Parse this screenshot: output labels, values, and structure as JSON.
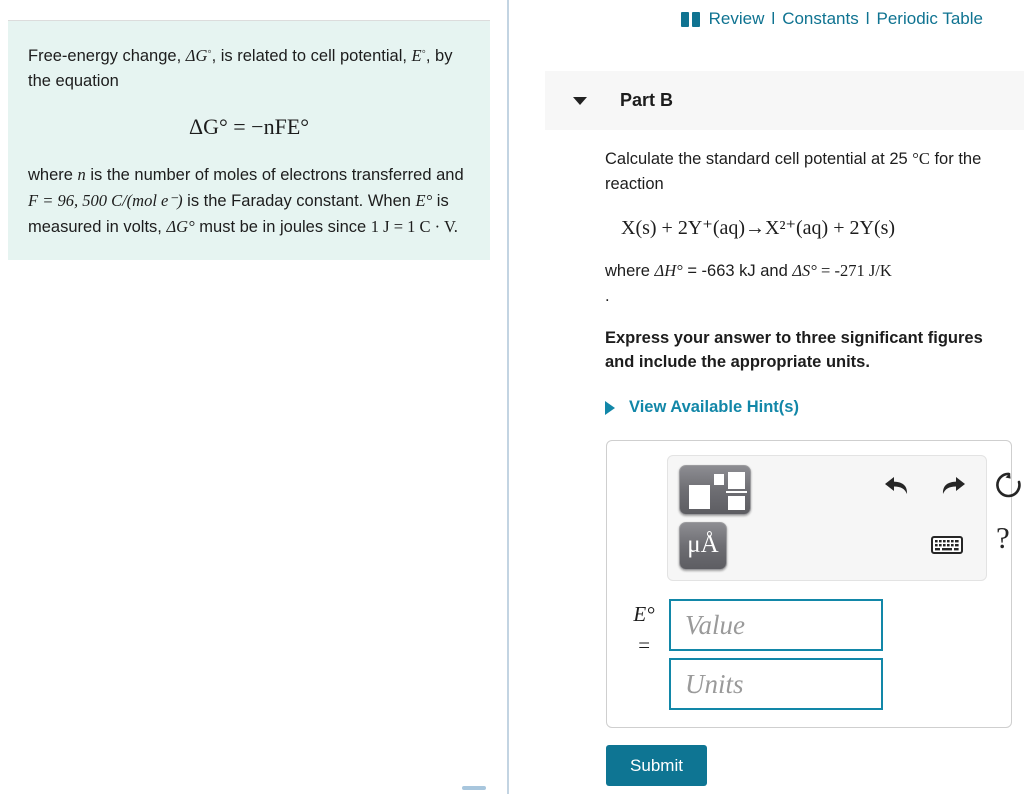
{
  "left_panel": {
    "hint_card": {
      "line1_a": "Free-energy change, ",
      "line1_dG": "ΔG",
      "line1_b": ", is related to cell potential, ",
      "line1_E": "E",
      "line1_c": ", by the equation",
      "equation": "ΔG° = −nFE°",
      "line2_a": "where ",
      "line2_n": "n",
      "line2_b": " is the number of moles of electrons transferred and ",
      "line2_F": "F = 96, 500 C/(mol e⁻)",
      "line2_c": " is the Faraday constant. When ",
      "line2_E": "E°",
      "line2_d": " is measured in volts, ",
      "line2_dG": "ΔG°",
      "line2_e": " must be in joules since ",
      "line2_J": "1 J = 1 C · V."
    }
  },
  "header": {
    "book_icon": "book-icon",
    "review_label": "Review",
    "separator": "l",
    "constants_label": "Constants",
    "periodic_table_label": "Periodic Table",
    "link_color": "#0f7391"
  },
  "part": {
    "caret_icon": "caret-down-icon",
    "title": "Part B"
  },
  "question": {
    "prompt_a": "Calculate the standard cell potential at 25 ",
    "prompt_deg_c": "°C",
    "prompt_b": " for the reaction",
    "reaction": "X(s) + 2Y⁺(aq)→X²⁺(aq) + 2Y(s)",
    "conditions_a": "where ",
    "conditions_dH": "ΔH°",
    "conditions_b": " = -663 kJ and ",
    "conditions_dS": "ΔS°",
    "conditions_c": " = -271 J/K",
    "lone_period": ".",
    "instruction": "Express your answer to three significant figures and include the appropriate units.",
    "hints_caret_icon": "caret-right-icon",
    "hints_label": "View Available Hint(s)",
    "hints_color": "#1287a8"
  },
  "answer": {
    "toolbar": {
      "fraction_template_label": "fraction-template",
      "unit_template_label": "μÅ",
      "undo_label": "undo-icon",
      "redo_label": "redo-icon",
      "reset_label": "reset-icon",
      "keyboard_label": "keyboard-icon",
      "help_label": "?"
    },
    "label_symbol": "E°",
    "label_equals": "=",
    "value_placeholder": "Value",
    "units_placeholder": "Units",
    "input_border_color": "#1287a8"
  },
  "submit": {
    "label": "Submit",
    "color": "#0e7593"
  }
}
